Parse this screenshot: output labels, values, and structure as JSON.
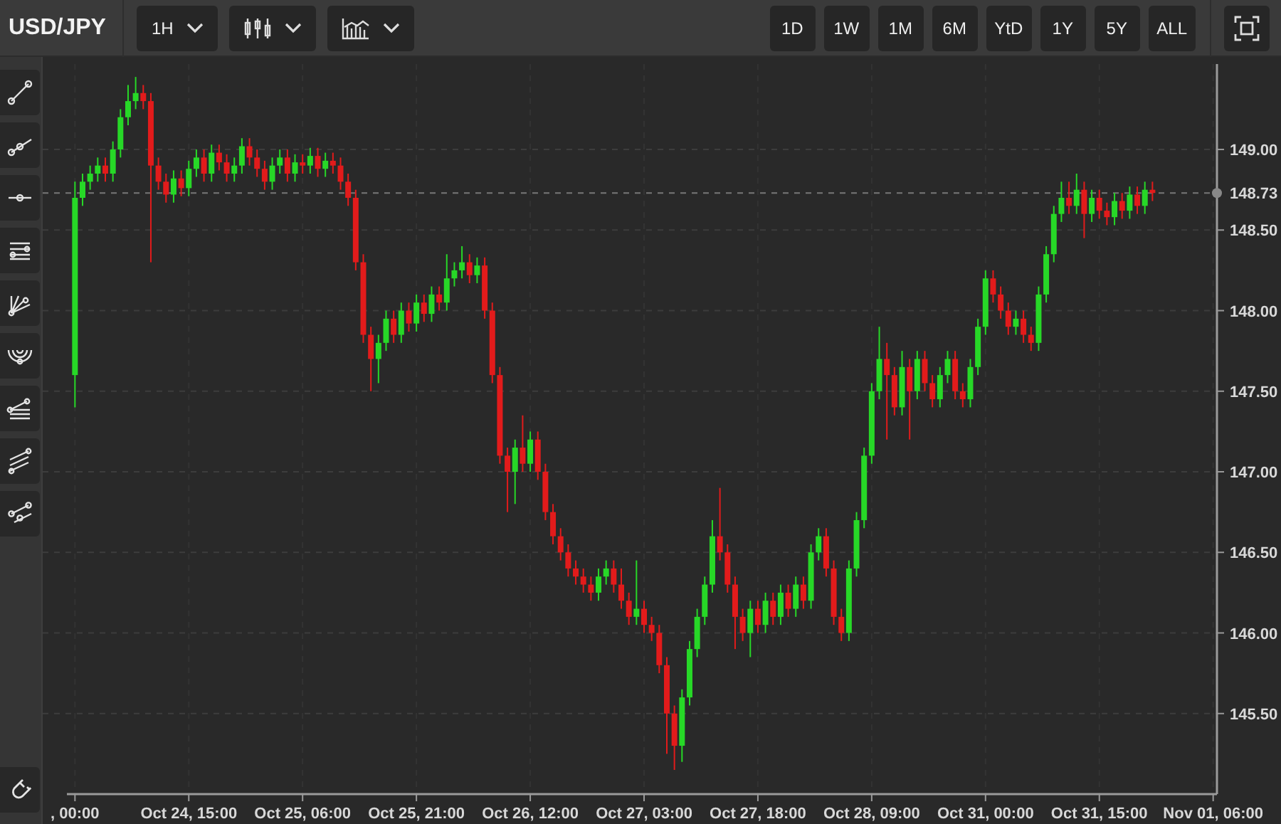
{
  "header": {
    "symbol": "USD/JPY",
    "interval": "1H",
    "range_buttons": [
      {
        "label": "1D"
      },
      {
        "label": "1W"
      },
      {
        "label": "1M"
      },
      {
        "label": "6M"
      },
      {
        "label": "YtD"
      },
      {
        "label": "1Y"
      },
      {
        "label": "5Y"
      },
      {
        "label": "ALL"
      }
    ]
  },
  "chart": {
    "chart_data": {
      "type": "candlestick",
      "grid": true,
      "ylim": [
        145.0,
        149.53
      ],
      "yticks": [
        {
          "value": 145.5,
          "label": "145.50"
        },
        {
          "value": 146,
          "label": "146.00"
        },
        {
          "value": 146.5,
          "label": "146.50"
        },
        {
          "value": 147,
          "label": "147.00"
        },
        {
          "value": 147.5,
          "label": "147.50"
        },
        {
          "value": 148,
          "label": "148.00"
        },
        {
          "value": 148.5,
          "label": "148.50"
        },
        {
          "value": 149,
          "label": "149.00"
        }
      ],
      "categories": [
        ", 00:00",
        null,
        null,
        null,
        null,
        null,
        null,
        null,
        null,
        null,
        null,
        null,
        null,
        null,
        null,
        "Oct 24, 15:00",
        null,
        null,
        null,
        null,
        null,
        null,
        null,
        null,
        null,
        null,
        null,
        null,
        null,
        null,
        "Oct 25, 06:00",
        null,
        null,
        null,
        null,
        null,
        null,
        null,
        null,
        null,
        null,
        null,
        null,
        null,
        null,
        "Oct 25, 21:00",
        null,
        null,
        null,
        null,
        null,
        null,
        null,
        null,
        null,
        null,
        null,
        null,
        null,
        null,
        "Oct 26, 12:00",
        null,
        null,
        null,
        null,
        null,
        null,
        null,
        null,
        null,
        null,
        null,
        null,
        null,
        null,
        "Oct 27, 03:00",
        null,
        null,
        null,
        null,
        null,
        null,
        null,
        null,
        null,
        null,
        null,
        null,
        null,
        null,
        "Oct 27, 18:00",
        null,
        null,
        null,
        null,
        null,
        null,
        null,
        null,
        null,
        null,
        null,
        null,
        null,
        null,
        "Oct 28, 09:00",
        null,
        null,
        null,
        null,
        null,
        null,
        null,
        null,
        null,
        null,
        null,
        null,
        null,
        null,
        "Oct 31, 00:00",
        null,
        null,
        null,
        null,
        null,
        null,
        null,
        null,
        null,
        null,
        null,
        null,
        null,
        null,
        "Oct 31, 15:00",
        null,
        null,
        null,
        null,
        null,
        null,
        null,
        null,
        null,
        null,
        null,
        null,
        null,
        null,
        "Nov 01, 06:00"
      ],
      "ref_lines": [
        {
          "axis": "y",
          "value": 148.73,
          "label": "148.73"
        }
      ],
      "ohlc": [
        [
          147.6,
          148.8,
          147.4,
          148.7
        ],
        [
          148.7,
          148.85,
          148.65,
          148.8
        ],
        [
          148.8,
          148.9,
          148.75,
          148.85
        ],
        [
          148.85,
          148.95,
          148.8,
          148.9
        ],
        [
          148.9,
          148.95,
          148.8,
          148.85
        ],
        [
          148.85,
          149.05,
          148.8,
          149.0
        ],
        [
          149.0,
          149.25,
          148.95,
          149.2
        ],
        [
          149.2,
          149.4,
          149.15,
          149.3
        ],
        [
          149.3,
          149.45,
          149.25,
          149.35
        ],
        [
          149.35,
          149.4,
          149.25,
          149.3
        ],
        [
          149.3,
          149.35,
          148.3,
          148.9
        ],
        [
          148.9,
          148.95,
          148.75,
          148.8
        ],
        [
          148.8,
          148.85,
          148.67,
          148.72
        ],
        [
          148.72,
          148.87,
          148.67,
          148.82
        ],
        [
          148.82,
          148.87,
          148.71,
          148.76
        ],
        [
          148.76,
          148.93,
          148.71,
          148.88
        ],
        [
          148.88,
          149.0,
          148.83,
          148.95
        ],
        [
          148.95,
          149.0,
          148.8,
          148.85
        ],
        [
          148.85,
          149.03,
          148.8,
          148.98
        ],
        [
          148.98,
          149.03,
          148.87,
          148.92
        ],
        [
          148.92,
          148.97,
          148.8,
          148.85
        ],
        [
          148.85,
          148.95,
          148.8,
          148.9
        ],
        [
          148.9,
          149.07,
          148.85,
          149.02
        ],
        [
          149.02,
          149.07,
          148.9,
          148.95
        ],
        [
          148.95,
          149.0,
          148.83,
          148.88
        ],
        [
          148.88,
          148.93,
          148.75,
          148.8
        ],
        [
          148.8,
          148.95,
          148.75,
          148.9
        ],
        [
          148.9,
          149.0,
          148.85,
          148.95
        ],
        [
          148.95,
          149.0,
          148.8,
          148.85
        ],
        [
          148.85,
          148.97,
          148.8,
          148.92
        ],
        [
          148.92,
          148.97,
          148.85,
          148.9
        ],
        [
          148.9,
          149.01,
          148.85,
          148.96
        ],
        [
          148.96,
          149.01,
          148.83,
          148.88
        ],
        [
          148.88,
          148.98,
          148.83,
          148.93
        ],
        [
          148.93,
          148.98,
          148.85,
          148.9
        ],
        [
          148.9,
          148.95,
          148.75,
          148.8
        ],
        [
          148.8,
          148.85,
          148.65,
          148.7
        ],
        [
          148.7,
          148.75,
          148.25,
          148.3
        ],
        [
          148.3,
          148.35,
          147.8,
          147.85
        ],
        [
          147.85,
          147.9,
          147.5,
          147.7
        ],
        [
          147.7,
          147.85,
          147.55,
          147.8
        ],
        [
          147.8,
          148.0,
          147.75,
          147.95
        ],
        [
          147.95,
          148.0,
          147.8,
          147.85
        ],
        [
          147.85,
          148.05,
          147.8,
          148.0
        ],
        [
          148.0,
          148.05,
          147.87,
          147.92
        ],
        [
          147.92,
          148.1,
          147.87,
          148.05
        ],
        [
          148.05,
          148.1,
          147.93,
          147.98
        ],
        [
          147.98,
          148.15,
          147.93,
          148.1
        ],
        [
          148.1,
          148.15,
          148.0,
          148.05
        ],
        [
          148.05,
          148.35,
          148.0,
          148.2
        ],
        [
          148.2,
          148.3,
          148.15,
          148.25
        ],
        [
          148.25,
          148.4,
          148.2,
          148.3
        ],
        [
          148.3,
          148.35,
          148.17,
          148.22
        ],
        [
          148.22,
          148.33,
          148.17,
          148.28
        ],
        [
          148.28,
          148.33,
          147.95,
          148.0
        ],
        [
          148.0,
          148.05,
          147.55,
          147.6
        ],
        [
          147.6,
          147.65,
          147.05,
          147.1
        ],
        [
          147.1,
          147.15,
          146.75,
          147.0
        ],
        [
          147.0,
          147.2,
          146.8,
          147.15
        ],
        [
          147.15,
          147.35,
          147.0,
          147.05
        ],
        [
          147.05,
          147.25,
          147.0,
          147.2
        ],
        [
          147.2,
          147.25,
          146.95,
          147.0
        ],
        [
          147.0,
          147.05,
          146.7,
          146.75
        ],
        [
          146.75,
          146.8,
          146.55,
          146.6
        ],
        [
          146.6,
          146.65,
          146.45,
          146.5
        ],
        [
          146.5,
          146.55,
          146.35,
          146.4
        ],
        [
          146.4,
          146.45,
          146.3,
          146.35
        ],
        [
          146.35,
          146.4,
          146.25,
          146.3
        ],
        [
          146.3,
          146.35,
          146.2,
          146.25
        ],
        [
          146.25,
          146.4,
          146.2,
          146.35
        ],
        [
          146.35,
          146.45,
          146.3,
          146.4
        ],
        [
          146.4,
          146.45,
          146.25,
          146.3
        ],
        [
          146.3,
          146.4,
          146.15,
          146.2
        ],
        [
          146.2,
          146.25,
          146.05,
          146.1
        ],
        [
          146.1,
          146.45,
          146.05,
          146.15
        ],
        [
          146.15,
          146.2,
          146.0,
          146.05
        ],
        [
          146.05,
          146.1,
          145.95,
          146.0
        ],
        [
          146.0,
          146.05,
          145.75,
          145.8
        ],
        [
          145.8,
          145.85,
          145.25,
          145.5
        ],
        [
          145.5,
          145.55,
          145.15,
          145.3
        ],
        [
          145.3,
          145.65,
          145.2,
          145.6
        ],
        [
          145.6,
          145.95,
          145.55,
          145.9
        ],
        [
          145.9,
          146.15,
          145.85,
          146.1
        ],
        [
          146.1,
          146.35,
          146.05,
          146.3
        ],
        [
          146.3,
          146.7,
          146.25,
          146.6
        ],
        [
          146.6,
          146.9,
          146.45,
          146.5
        ],
        [
          146.5,
          146.55,
          146.25,
          146.3
        ],
        [
          146.3,
          146.35,
          145.9,
          146.1
        ],
        [
          146.1,
          146.15,
          145.95,
          146.0
        ],
        [
          146.0,
          146.2,
          145.85,
          146.15
        ],
        [
          146.15,
          146.2,
          146.0,
          146.05
        ],
        [
          146.05,
          146.25,
          146.0,
          146.2
        ],
        [
          146.2,
          146.25,
          146.05,
          146.1
        ],
        [
          146.1,
          146.3,
          146.05,
          146.25
        ],
        [
          146.25,
          146.3,
          146.1,
          146.15
        ],
        [
          146.15,
          146.35,
          146.1,
          146.3
        ],
        [
          146.3,
          146.35,
          146.15,
          146.2
        ],
        [
          146.2,
          146.55,
          146.15,
          146.5
        ],
        [
          146.5,
          146.65,
          146.45,
          146.6
        ],
        [
          146.6,
          146.65,
          146.35,
          146.4
        ],
        [
          146.4,
          146.45,
          146.05,
          146.1
        ],
        [
          146.1,
          146.15,
          145.95,
          146.0
        ],
        [
          146.0,
          146.45,
          145.95,
          146.4
        ],
        [
          146.4,
          146.75,
          146.35,
          146.7
        ],
        [
          146.7,
          147.15,
          146.65,
          147.1
        ],
        [
          147.1,
          147.55,
          147.05,
          147.5
        ],
        [
          147.5,
          147.9,
          147.45,
          147.7
        ],
        [
          147.7,
          147.8,
          147.2,
          147.6
        ],
        [
          147.6,
          147.65,
          147.35,
          147.4
        ],
        [
          147.4,
          147.75,
          147.35,
          147.65
        ],
        [
          147.65,
          147.7,
          147.2,
          147.5
        ],
        [
          147.5,
          147.75,
          147.45,
          147.7
        ],
        [
          147.7,
          147.75,
          147.5,
          147.55
        ],
        [
          147.55,
          147.6,
          147.4,
          147.45
        ],
        [
          147.45,
          147.65,
          147.4,
          147.6
        ],
        [
          147.6,
          147.75,
          147.55,
          147.7
        ],
        [
          147.7,
          147.75,
          147.45,
          147.5
        ],
        [
          147.5,
          147.55,
          147.4,
          147.45
        ],
        [
          147.45,
          147.7,
          147.4,
          147.65
        ],
        [
          147.65,
          147.95,
          147.6,
          147.9
        ],
        [
          147.9,
          148.25,
          147.85,
          148.2
        ],
        [
          148.2,
          148.25,
          148.05,
          148.1
        ],
        [
          148.1,
          148.15,
          147.95,
          148.0
        ],
        [
          148.0,
          148.05,
          147.85,
          147.9
        ],
        [
          147.9,
          148.0,
          147.85,
          147.95
        ],
        [
          147.95,
          148.0,
          147.8,
          147.85
        ],
        [
          147.85,
          147.9,
          147.75,
          147.8
        ],
        [
          147.8,
          148.15,
          147.75,
          148.1
        ],
        [
          148.1,
          148.4,
          148.05,
          148.35
        ],
        [
          148.35,
          148.65,
          148.3,
          148.6
        ],
        [
          148.6,
          148.8,
          148.55,
          148.7
        ],
        [
          148.7,
          148.8,
          148.6,
          148.65
        ],
        [
          148.65,
          148.85,
          148.6,
          148.75
        ],
        [
          148.75,
          148.8,
          148.45,
          148.6
        ],
        [
          148.6,
          148.75,
          148.55,
          148.7
        ],
        [
          148.7,
          148.75,
          148.57,
          148.62
        ],
        [
          148.62,
          148.67,
          148.53,
          148.58
        ],
        [
          148.58,
          148.73,
          148.53,
          148.68
        ],
        [
          148.68,
          148.73,
          148.57,
          148.62
        ],
        [
          148.62,
          148.77,
          148.57,
          148.72
        ],
        [
          148.72,
          148.77,
          148.6,
          148.65
        ],
        [
          148.65,
          148.8,
          148.6,
          148.75
        ],
        [
          148.75,
          148.8,
          148.68,
          148.73
        ],
        null,
        null,
        null,
        null,
        null,
        null,
        null,
        null
      ]
    }
  }
}
